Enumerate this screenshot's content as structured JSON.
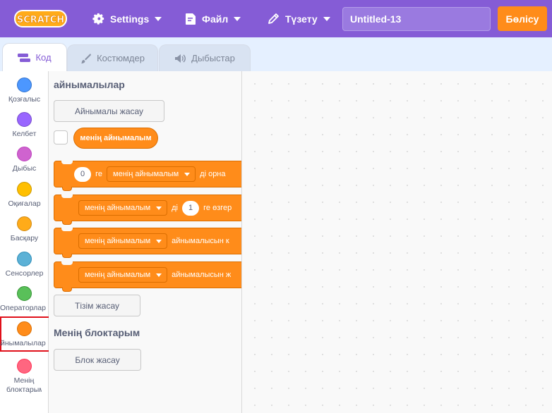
{
  "menubar": {
    "logo_text": "SCRATCH",
    "settings_label": "Settings",
    "file_label": "Файл",
    "edit_label": "Түзету",
    "project_title": "Untitled-13",
    "share_label": "Бөлісу"
  },
  "tabs": [
    {
      "label": "Код"
    },
    {
      "label": "Костюмдер"
    },
    {
      "label": "Дыбыстар"
    }
  ],
  "categories": [
    {
      "label": "Қозғалыс",
      "color": "#4c97ff"
    },
    {
      "label": "Келбет",
      "color": "#9966ff"
    },
    {
      "label": "Дыбыс",
      "color": "#cf63cf"
    },
    {
      "label": "Оқиғалар",
      "color": "#ffbf00"
    },
    {
      "label": "Басқару",
      "color": "#ffab19"
    },
    {
      "label": "Сенсорлер",
      "color": "#5cb1d6"
    },
    {
      "label": "Операторлар",
      "color": "#59c059"
    },
    {
      "label": "Айнымалылар",
      "color": "#ff8c1a"
    },
    {
      "label": "Менің блоктарым",
      "color": "#ff6680"
    }
  ],
  "flyout": {
    "variables_heading": "айнымалылар",
    "make_variable_label": "Айнымалы жасау",
    "variable_reporter": "менің айнымалым",
    "blocks": [
      {
        "value": "0",
        "prefix": "ге",
        "var": "менің айнымалым",
        "suffix": "ді орна"
      },
      {
        "var": "менің айнымалым",
        "mid": "ді",
        "value": "1",
        "suffix": "ге өзгер"
      },
      {
        "var": "менің айнымалым",
        "suffix": "айнымалысын к"
      },
      {
        "var": "менің айнымалым",
        "suffix": "айнымалысын ж"
      }
    ],
    "make_list_label": "Тізім жасау",
    "myblocks_heading": "Менің блоктарым",
    "make_block_label": "Блок жасау"
  },
  "colors": {
    "menubar": "#855cd6",
    "variables": "#ff8c1a",
    "share": "#ff8c1a"
  }
}
